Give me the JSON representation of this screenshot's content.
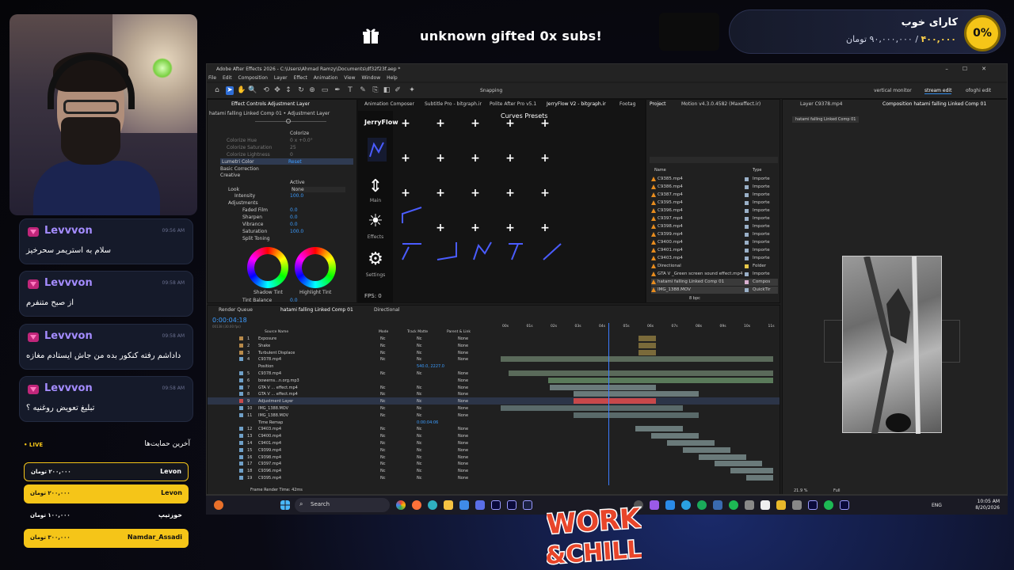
{
  "overlay": {
    "gift_text": "unknown gifted 0x subs!",
    "goal_title": "کارای خوب",
    "goal_current": "۴۰۰,۰۰۰",
    "goal_target": "۹۰,۰۰۰,۰۰۰ تومان",
    "goal_sep": "/",
    "goal_percent": "0%"
  },
  "chat": [
    {
      "user": "Levvvon",
      "time": "09:56 AM",
      "message": "سلام به استریمر سحرخیز"
    },
    {
      "user": "Levvvon",
      "time": "09:58 AM",
      "message": "از صبح متنفرم"
    },
    {
      "user": "Levvvon",
      "time": "09:58 AM",
      "message": "داداشم رفته کنکور بده من جاش ایستادم مغازه"
    },
    {
      "user": "Levvvon",
      "time": "09:58 AM",
      "message": "تبلیغ تعویض روغنیه ؟"
    }
  ],
  "donations": {
    "live": "• LIVE",
    "title": "آخرین حمایت‌ها",
    "items": [
      {
        "name": "Levon",
        "amount": "۲۰۰,۰۰۰ تومان",
        "style": "outline"
      },
      {
        "name": "Levon",
        "amount": "۲۰۰,۰۰۰ تومان",
        "style": "filled"
      },
      {
        "name": "خوزتیپ",
        "amount": "۱۰۰,۰۰۰ تومان",
        "style": "plain"
      },
      {
        "name": "Namdar_Assadi",
        "amount": "۳۰۰,۰۰۰ تومان",
        "style": "filled"
      }
    ]
  },
  "ae": {
    "title": "Adobe After Effects 2026 - C:\\Users\\Ahmad Ramzy\\Documents\\df32f23f.aep *",
    "menu": [
      "File",
      "Edit",
      "Composition",
      "Layer",
      "Effect",
      "Animation",
      "View",
      "Window",
      "Help"
    ],
    "snapping": "Snapping",
    "workspaces": [
      "vertical monitor",
      "stream edit",
      "ofoghi edit"
    ],
    "effect_controls": {
      "tab": "Effect Controls Adjustment Layer",
      "subtitle": "hatami falling Linked Comp 01 • Adjustment Layer",
      "colorize": "Colorize",
      "colorize_hue": "Colorize Hue",
      "colorize_hue_val": "0 x +0.0°",
      "colorize_saturation": "Colorize Saturation",
      "colorize_saturation_val": "25",
      "colorize_lightness": "Colorize Lightness",
      "colorize_lightness_val": "0",
      "lumetri": "Lumetri Color",
      "reset": "Reset",
      "basic": "Basic Correction",
      "creative": "Creative",
      "active": "Active",
      "look": "Look",
      "look_val": "None",
      "intensity": "Intensity",
      "intensity_val": "100.0",
      "adjustments": "Adjustments",
      "faded": "Faded Film",
      "faded_val": "0.0",
      "sharpen": "Sharpen",
      "sharpen_val": "0.0",
      "vibrance": "Vibrance",
      "vibrance_val": "0.0",
      "saturation": "Saturation",
      "saturation_val": "100.0",
      "split": "Split Toning",
      "shadow": "Shadow Tint",
      "highlight": "Highlight Tint",
      "tint_balance": "Tint Balance",
      "tint_balance_val": "0.0"
    },
    "jerryflow": {
      "tabs": [
        "Animation Composer",
        "Subtitle Pro - bitgraph.ir",
        "Polite After Pro v5.1",
        "JerryFlow V2 - bitgraph.ir",
        "Footag"
      ],
      "brand": "JerryFlow",
      "heading": "Curves Presets",
      "side": [
        "Main",
        "Effects",
        "Settings"
      ],
      "fps": "FPS: 0"
    },
    "project": {
      "tabs": [
        "Project",
        "Motion v4.3.0.4582 (Maxeffect.ir)"
      ],
      "col_name": "Name",
      "col_type": "Type",
      "bpc": "8 bpc",
      "rows": [
        {
          "name": "C9385.mp4",
          "type": "Importe",
          "color": "#9ab0c8"
        },
        {
          "name": "C9386.mp4",
          "type": "Importe",
          "color": "#9ab0c8"
        },
        {
          "name": "C9387.mp4",
          "type": "Importe",
          "color": "#9ab0c8"
        },
        {
          "name": "C9395.mp4",
          "type": "Importe",
          "color": "#9ab0c8"
        },
        {
          "name": "C9396.mp4",
          "type": "Importe",
          "color": "#9ab0c8"
        },
        {
          "name": "C9397.mp4",
          "type": "Importe",
          "color": "#9ab0c8"
        },
        {
          "name": "C9398.mp4",
          "type": "Importe",
          "color": "#9ab0c8"
        },
        {
          "name": "C9399.mp4",
          "type": "Importe",
          "color": "#9ab0c8"
        },
        {
          "name": "C9400.mp4",
          "type": "Importe",
          "color": "#9ab0c8"
        },
        {
          "name": "C9401.mp4",
          "type": "Importe",
          "color": "#9ab0c8"
        },
        {
          "name": "C9403.mp4",
          "type": "Importe",
          "color": "#9ab0c8"
        },
        {
          "name": "Directional",
          "type": "Folder",
          "color": "#e8c84a"
        },
        {
          "name": "GTA V _Green screen sound effect.mp4",
          "type": "Importe",
          "color": "#9ab0c8"
        },
        {
          "name": "hatami falling Linked Comp 01",
          "type": "Compos",
          "color": "#d8b0d0"
        },
        {
          "name": "IMG_1388.MOV",
          "type": "QuickTir",
          "color": "#9ab0c8"
        }
      ]
    },
    "viewer": {
      "tabs": [
        "Layer C9378.mp4",
        "Composition hatami falling Linked Comp 01"
      ],
      "comp_chip": "hatami falling Linked Comp 01",
      "zoom": "21.9 %",
      "quality": "Full"
    },
    "timeline": {
      "tabs": [
        "Render Queue",
        "hatami falling Linked Comp 01",
        "Directional"
      ],
      "timecode": "0:00:04:18",
      "fps_note": "00138 (30.00 fps)",
      "headers": [
        "Source Name",
        "Mode",
        "Track Matte",
        "Parent & Link"
      ],
      "ruler": [
        "00s",
        "01s",
        "02s",
        "03s",
        "04s",
        "05s",
        "06s",
        "07s",
        "08s",
        "09s",
        "10s",
        "11s"
      ],
      "footer": "Frame Render Time: 42ms",
      "layers": [
        {
          "num": "1",
          "name": "Exposure",
          "color": "#b88a4a",
          "mode": "Nc",
          "tm": "Nc",
          "par": "None"
        },
        {
          "num": "2",
          "name": "Shake",
          "color": "#b88a4a",
          "mode": "Nc",
          "tm": "Nc",
          "par": "None"
        },
        {
          "num": "3",
          "name": "Turbulent Displace",
          "color": "#b88a4a",
          "mode": "Nc",
          "tm": "Nc",
          "par": "None"
        },
        {
          "num": "4",
          "name": "C9378.mp4",
          "color": "#6fa0c8",
          "mode": "Nc",
          "tm": "Nc",
          "par": "None"
        },
        {
          "num": "",
          "name": "Position",
          "color": "",
          "mode": "",
          "tm": "540.0, 2227.0",
          "par": ""
        },
        {
          "num": "5",
          "name": "C9378.mp4",
          "color": "#6fa0c8",
          "mode": "Nc",
          "tm": "Nc",
          "par": "None"
        },
        {
          "num": "6",
          "name": "bowerns...n.org.mp3",
          "color": "#6fa0c8",
          "mode": "",
          "tm": "",
          "par": "None"
        },
        {
          "num": "7",
          "name": "GTA V ... effect.mp4",
          "color": "#6fa0c8",
          "mode": "Nc",
          "tm": "Nc",
          "par": "None"
        },
        {
          "num": "8",
          "name": "GTA V ... effect.mp4",
          "color": "#6fa0c8",
          "mode": "Nc",
          "tm": "Nc",
          "par": "None"
        },
        {
          "num": "9",
          "name": "Adjustment Layer",
          "color": "#c84a4a",
          "mode": "Nc",
          "tm": "Nc",
          "par": "None"
        },
        {
          "num": "10",
          "name": "IMG_1388.MOV",
          "color": "#6fa0c8",
          "mode": "Nc",
          "tm": "Nc",
          "par": "None"
        },
        {
          "num": "11",
          "name": "IMG_1388.MOV",
          "color": "#6fa0c8",
          "mode": "Nc",
          "tm": "Nc",
          "par": "None"
        },
        {
          "num": "",
          "name": "Time Remap",
          "color": "",
          "mode": "",
          "tm": "0:00:04:06",
          "par": ""
        },
        {
          "num": "12",
          "name": "C9403.mp4",
          "color": "#6fa0c8",
          "mode": "Nc",
          "tm": "Nc",
          "par": "None"
        },
        {
          "num": "13",
          "name": "C9400.mp4",
          "color": "#6fa0c8",
          "mode": "Nc",
          "tm": "Nc",
          "par": "None"
        },
        {
          "num": "14",
          "name": "C9401.mp4",
          "color": "#6fa0c8",
          "mode": "Nc",
          "tm": "Nc",
          "par": "None"
        },
        {
          "num": "15",
          "name": "C9399.mp4",
          "color": "#6fa0c8",
          "mode": "Nc",
          "tm": "Nc",
          "par": "None"
        },
        {
          "num": "16",
          "name": "C9398.mp4",
          "color": "#6fa0c8",
          "mode": "Nc",
          "tm": "Nc",
          "par": "None"
        },
        {
          "num": "17",
          "name": "C9397.mp4",
          "color": "#6fa0c8",
          "mode": "Nc",
          "tm": "Nc",
          "par": "None"
        },
        {
          "num": "18",
          "name": "C9396.mp4",
          "color": "#6fa0c8",
          "mode": "Nc",
          "tm": "Nc",
          "par": "None"
        },
        {
          "num": "19",
          "name": "C9395.mp4",
          "color": "#6fa0c8",
          "mode": "Nc",
          "tm": "Nc",
          "par": "None"
        }
      ]
    }
  },
  "taskbar": {
    "search": "Search",
    "lang": "ENG",
    "time": "10:05 AM",
    "date": "8/20/2026"
  },
  "logo": {
    "line1": "WORK",
    "line2": "&CHILL"
  }
}
